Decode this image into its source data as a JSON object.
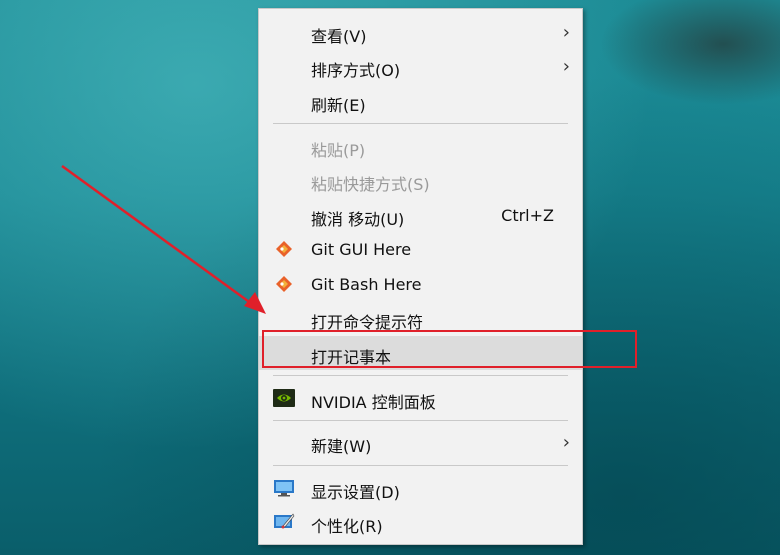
{
  "context_menu": {
    "items": [
      {
        "label": "查看(V)",
        "submenu": true
      },
      {
        "label": "排序方式(O)",
        "submenu": true
      },
      {
        "label": "刷新(E)"
      },
      {
        "label": "粘贴(P)",
        "disabled": true
      },
      {
        "label": "粘贴快捷方式(S)",
        "disabled": true
      },
      {
        "label": "撤消 移动(U)",
        "shortcut": "Ctrl+Z"
      },
      {
        "label": "Git GUI Here",
        "icon": "git-icon"
      },
      {
        "label": "Git Bash Here",
        "icon": "git-icon"
      },
      {
        "label": "打开命令提示符"
      },
      {
        "label": "打开记事本",
        "highlighted": true
      },
      {
        "label": "NVIDIA 控制面板",
        "icon": "nvidia-icon"
      },
      {
        "label": "新建(W)",
        "submenu": true
      },
      {
        "label": "显示设置(D)",
        "icon": "display-settings-icon"
      },
      {
        "label": "个性化(R)",
        "icon": "personalize-icon"
      }
    ]
  },
  "colors": {
    "annotation": "#e0202a",
    "menu_bg": "#f2f2f2",
    "hover_bg": "#dcdcdc"
  }
}
